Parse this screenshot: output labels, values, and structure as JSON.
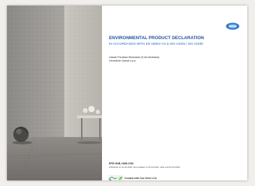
{
  "document": {
    "title": "ENVIRONMENTAL PRODUCT DECLARATION",
    "subtitle": "IN ACCORDANCE WITH EN 15804+A2 & ISO 14025 / ISO 21930",
    "product": "Caesar Porcelain Stoneware (9 mm thickness)",
    "company": "Ceramiche Caesar s.p.a.",
    "epd_code": "EPD HUB, HUB-1782",
    "publication_info": "Published on 01.03.2024, last updated on 01.03.2024, valid until 01.03.2029.",
    "footer_text": "Created with One Click LCA"
  },
  "logos": {
    "header_logo": "epd-hub-logo",
    "footer_logo": "one-click-lca-logo"
  },
  "colors": {
    "title": "#1b4f9c",
    "subtitle": "#1f63c9",
    "background": "#f1efec"
  }
}
